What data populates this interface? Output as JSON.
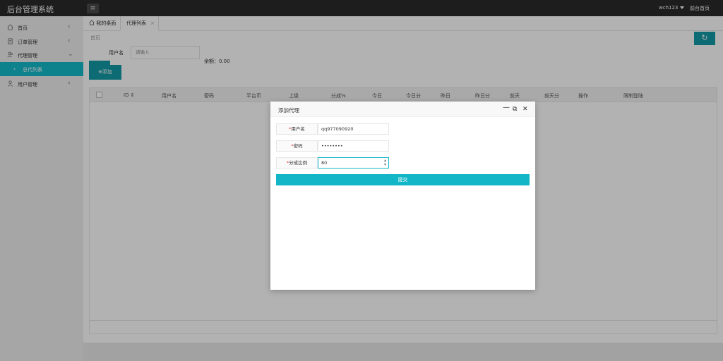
{
  "app": {
    "title": "后台管理系统",
    "menu_icon": "hamburger-icon"
  },
  "header": {
    "user": "wch123",
    "front_link": "前台首页"
  },
  "sidebar": {
    "items": [
      {
        "label": "首页",
        "icon": "home-icon",
        "chevron": "‹"
      },
      {
        "label": "订单管理",
        "icon": "document-icon",
        "chevron": "‹"
      },
      {
        "label": "代理管理",
        "icon": "users-icon",
        "chevron": "⌄"
      },
      {
        "label": "总代列表",
        "arrow": "›"
      },
      {
        "label": "用户管理",
        "icon": "user-icon",
        "chevron": "‹"
      }
    ]
  },
  "tabs": [
    {
      "label": "我的桌面",
      "icon": "home-icon"
    },
    {
      "label": "代理列表",
      "close": "×"
    }
  ],
  "main": {
    "breadcrumb": "首页",
    "refresh_icon": "↻",
    "search": {
      "label": "用户名",
      "placeholder": "请输入"
    },
    "balance": "余额：0.00",
    "add_button": "⊕添加",
    "table": {
      "columns": [
        "ID ⇕",
        "用户名",
        "密码",
        "平台币",
        "上级",
        "分成%",
        "今日",
        "今日分",
        "昨日",
        "昨日分",
        "前天",
        "前天分",
        "操作",
        "限制登陆"
      ]
    }
  },
  "modal": {
    "title": "添加代理",
    "controls": {
      "minimize": "—",
      "maximize": "⧉",
      "close": "✕"
    },
    "fields": [
      {
        "required": "*",
        "label": "用户名",
        "value": "qq977090920"
      },
      {
        "required": "*",
        "label": "密码",
        "value": "••••••••"
      },
      {
        "required": "*",
        "label": "分成比例",
        "value": "80"
      }
    ],
    "submit": "提交"
  },
  "colors": {
    "accent": "#14b9c9",
    "topbar": "#2a2a2a"
  }
}
